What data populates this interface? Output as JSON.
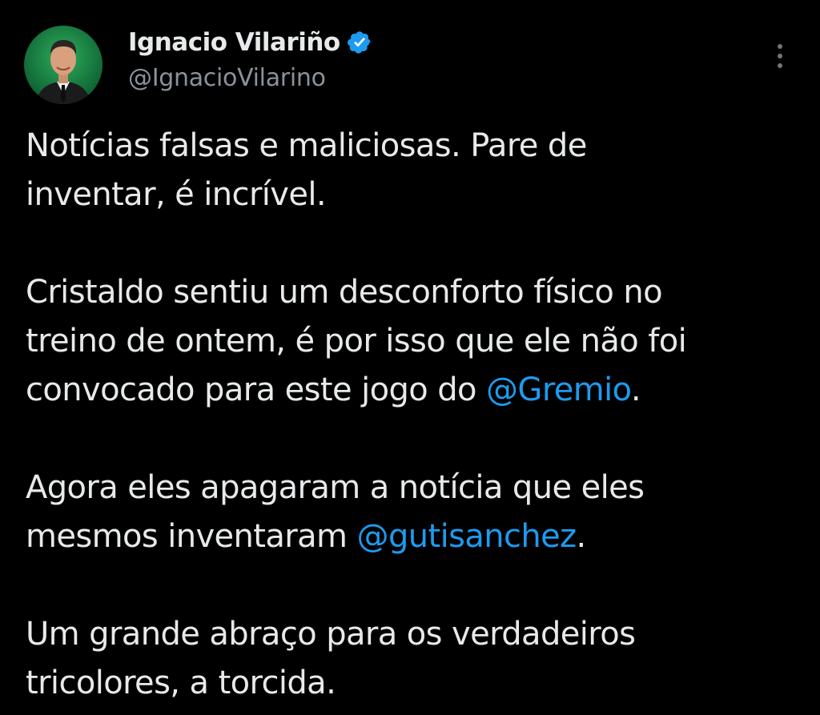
{
  "author": {
    "display_name": "Ignacio Vilariño",
    "handle": "@IgnacioVilarino",
    "verified_icon": "verified-badge-icon",
    "verified_color": "#1d9bf0"
  },
  "menu": {
    "icon": "more-vertical-icon"
  },
  "tweet": {
    "paragraphs": [
      {
        "lines": [
          {
            "text": "Notícias falsas e maliciosas. Pare de"
          },
          {
            "text": "inventar, é incrível."
          }
        ]
      },
      {
        "lines": [
          {
            "text": "Cristaldo sentiu um desconforto físico no"
          },
          {
            "text": "treino de ontem, é por isso que ele não foi"
          },
          {
            "text": "convocado para este jogo do ",
            "mention": "@Gremio",
            "after": "."
          }
        ]
      },
      {
        "lines": [
          {
            "text": "Agora eles apagaram a notícia que eles"
          },
          {
            "text": "mesmos inventaram ",
            "mention": "@gutisanchez",
            "after": "."
          }
        ]
      },
      {
        "lines": [
          {
            "text": "Um grande abraço para os verdadeiros"
          },
          {
            "text": "tricolores, a torcida."
          }
        ]
      }
    ]
  },
  "colors": {
    "background": "#000000",
    "text": "#e7e9ea",
    "secondary_text": "#8b9299",
    "link": "#1d9bf0"
  }
}
